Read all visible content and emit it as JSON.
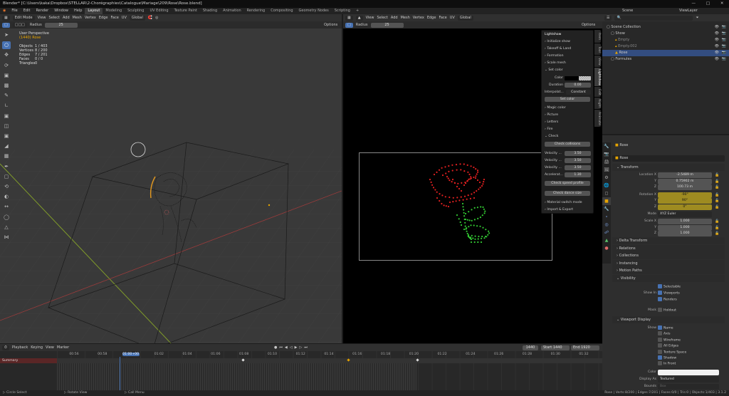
{
  "titlebar": {
    "title": "Blender* [C:\\Users\\kaka\\Dropbox\\STELLAR\\2-Chorégraphies\\Catalogue\\Mariage\\209\\Rose\\Rose.blend]"
  },
  "menubar": {
    "menus": [
      "File",
      "Edit",
      "Render",
      "Window",
      "Help"
    ],
    "workspaces": [
      "Layout",
      "Modeling",
      "Sculpting",
      "UV Editing",
      "Texture Paint",
      "Shading",
      "Animation",
      "Rendering",
      "Compositing",
      "Geometry Nodes",
      "Scripting"
    ],
    "active_workspace": "Layout",
    "scene": "Scene",
    "view_layer": "ViewLayer"
  },
  "left_viewport": {
    "mode": "Edit Mode",
    "menus": [
      "View",
      "Select",
      "Add",
      "Mesh",
      "Vertex",
      "Edge",
      "Face",
      "UV"
    ],
    "transform_orientation": "Global",
    "radius_label": "Radius",
    "radius_value": "25",
    "options_label": "Options",
    "view_name": "User Perspective",
    "object_name": "(1440) Rose",
    "stats": [
      {
        "label": "Objects",
        "value": "1 / 403"
      },
      {
        "label": "Vertices",
        "value": "8 / 200"
      },
      {
        "label": "Edges",
        "value": "7 / 201"
      },
      {
        "label": "Faces",
        "value": "0 / 0"
      },
      {
        "label": "Triangles",
        "value": "0"
      }
    ],
    "tools": [
      "cursor-icon",
      "select-icon",
      "move-icon",
      "rotate-icon",
      "scale-icon",
      "transform-icon",
      "annotate-icon",
      "measure-icon",
      "add-cube-icon",
      "extrude-icon",
      "inset-icon",
      "bevel-icon",
      "loopcut-icon",
      "knife-icon",
      "polybuild-icon",
      "spin-icon",
      "smooth-icon",
      "edge-slide-icon",
      "shrink-icon",
      "shear-icon",
      "rip-icon"
    ]
  },
  "right_viewport": {
    "menus": [
      "View",
      "Select",
      "Add",
      "Mesh",
      "Vertex",
      "Edge",
      "Face",
      "UV"
    ],
    "transform_orientation": "Global",
    "radius_label": "Radius",
    "radius_value": "25",
    "options_label": "Options"
  },
  "lightshow_panel": {
    "title": "Lightshow",
    "sections": [
      "Initialize show",
      "Takeoff & Land",
      "Formation",
      "Scale mesh"
    ],
    "set_color": {
      "title": "Set color",
      "color_label": "Color",
      "duration_label": "Duration",
      "duration_value": "0.00",
      "interpolation_label": "Interpolat...",
      "interpolation_value": "Constant",
      "button": "Set color"
    },
    "more_sections": [
      "Magic color",
      "Picture",
      "Letters",
      "Fire"
    ],
    "check": {
      "title": "Check",
      "collisions_button": "Check collisions",
      "velocity_rows": [
        {
          "label": "Velocity ...",
          "value": "3.50"
        },
        {
          "label": "Velocity ...",
          "value": "3.50"
        },
        {
          "label": "Velocity ...",
          "value": "3.50"
        },
        {
          "label": "Accelerat...",
          "value": "1.30"
        }
      ],
      "speed_button": "Check speed profile",
      "dance_button": "Check dance size"
    },
    "tail_sections": [
      "Material switch mode",
      "Import & Export"
    ],
    "side_tabs": [
      "Item",
      "Tool",
      "View",
      "Lightshow",
      "Edit",
      "Night",
      "Animate"
    ],
    "active_tab": "Lightshow"
  },
  "outliner": {
    "rows": [
      {
        "name": "Scene Collection",
        "indent": 0,
        "selected": false
      },
      {
        "name": "Show",
        "indent": 1,
        "selected": false
      },
      {
        "name": "Empty",
        "indent": 2,
        "selected": false
      },
      {
        "name": "Empty.002",
        "indent": 2,
        "selected": false
      },
      {
        "name": "Rose",
        "indent": 2,
        "selected": true
      },
      {
        "name": "Formules",
        "indent": 1,
        "selected": false
      }
    ]
  },
  "properties": {
    "object_name": "Rose",
    "data_name": "Rose",
    "transform": {
      "title": "Transform",
      "location": [
        {
          "label": "Location X",
          "value": "-2.5489 m"
        },
        {
          "label": "Y",
          "value": "0.75902 m"
        },
        {
          "label": "Z",
          "value": "100.73 m"
        }
      ],
      "rotation": [
        {
          "label": "Rotation X",
          "value": "-90°"
        },
        {
          "label": "Y",
          "value": "90°"
        },
        {
          "label": "Z",
          "value": "0°"
        }
      ],
      "mode_label": "Mode",
      "mode_value": "XYZ Euler",
      "scale": [
        {
          "label": "Scale X",
          "value": "1.000"
        },
        {
          "label": "Y",
          "value": "1.000"
        },
        {
          "label": "Z",
          "value": "1.000"
        }
      ]
    },
    "collapsed_sections": [
      "Delta Transform",
      "Relations",
      "Collections",
      "Instancing",
      "Motion Paths"
    ],
    "visibility": {
      "title": "Visibility",
      "selectable": "Selectable",
      "show_in_label": "Show In",
      "viewports": "Viewports",
      "renders": "Renders",
      "mask_label": "Mask",
      "holdout": "Holdout"
    },
    "viewport_display": {
      "title": "Viewport Display",
      "show_label": "Show",
      "items": [
        {
          "label": "Name",
          "checked": true
        },
        {
          "label": "Axis",
          "checked": false
        },
        {
          "label": "Wireframe",
          "checked": false
        },
        {
          "label": "All Edges",
          "checked": false
        },
        {
          "label": "Texture Space",
          "checked": false
        },
        {
          "label": "Shadow",
          "checked": true
        },
        {
          "label": "In Front",
          "checked": false
        }
      ],
      "color_label": "Color",
      "display_as_label": "Display As",
      "display_as_value": "Textured",
      "bounds_label": "Bounds",
      "bounds_value": "Box"
    }
  },
  "timeline": {
    "menus": [
      "Playback",
      "Keying",
      "View",
      "Marker"
    ],
    "current_frame": "1440",
    "start_label": "Start",
    "start_value": "1440",
    "end_label": "End",
    "end_value": "1920",
    "ticks": [
      "00:56",
      "00:58",
      "01:00+00",
      "01:02",
      "01:04",
      "01:06",
      "01:08",
      "01:10",
      "01:12",
      "01:14",
      "01:16",
      "01:18",
      "01:20",
      "01:22",
      "01:24",
      "01:26",
      "01:28",
      "01:30",
      "01:32"
    ],
    "playhead_fraction": 0.115,
    "summary_label": "Summary"
  },
  "statusbar": {
    "left": [
      {
        "key": "mouse-left-icon",
        "label": "Circle Select"
      },
      {
        "key": "mouse-mid-icon",
        "label": "Rotate View"
      },
      {
        "key": "mouse-right-icon",
        "label": "Call Menu"
      }
    ],
    "right": "Rose | Verts:8/200 | Edges:7/201 | Faces:0/0 | Tris:0 | Objects:1/403 | 3.1.2"
  },
  "colors": {
    "accent": "#4772b3",
    "rose_red": "#e02020",
    "stem_green": "#32c832",
    "keyframe_yellow": "#e6a400"
  }
}
